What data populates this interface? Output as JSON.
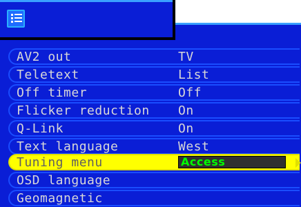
{
  "menu": {
    "icon": "menu-list-icon",
    "selected_index": 6,
    "items": [
      {
        "label": "AV2 out",
        "value": "TV"
      },
      {
        "label": "Teletext",
        "value": "List"
      },
      {
        "label": "Off timer",
        "value": "Off"
      },
      {
        "label": "Flicker reduction",
        "value": "On"
      },
      {
        "label": "Q-Link",
        "value": "On"
      },
      {
        "label": "Text language",
        "value": "West"
      },
      {
        "label": "Tuning menu",
        "value": "Access"
      },
      {
        "label": "OSD language",
        "value": ""
      },
      {
        "label": "Geomagnetic",
        "value": ""
      }
    ]
  },
  "colors": {
    "background": "#0a1ed6",
    "row_border": "#1a4dff",
    "highlight": "#ffff00",
    "access_text": "#00ff00"
  }
}
